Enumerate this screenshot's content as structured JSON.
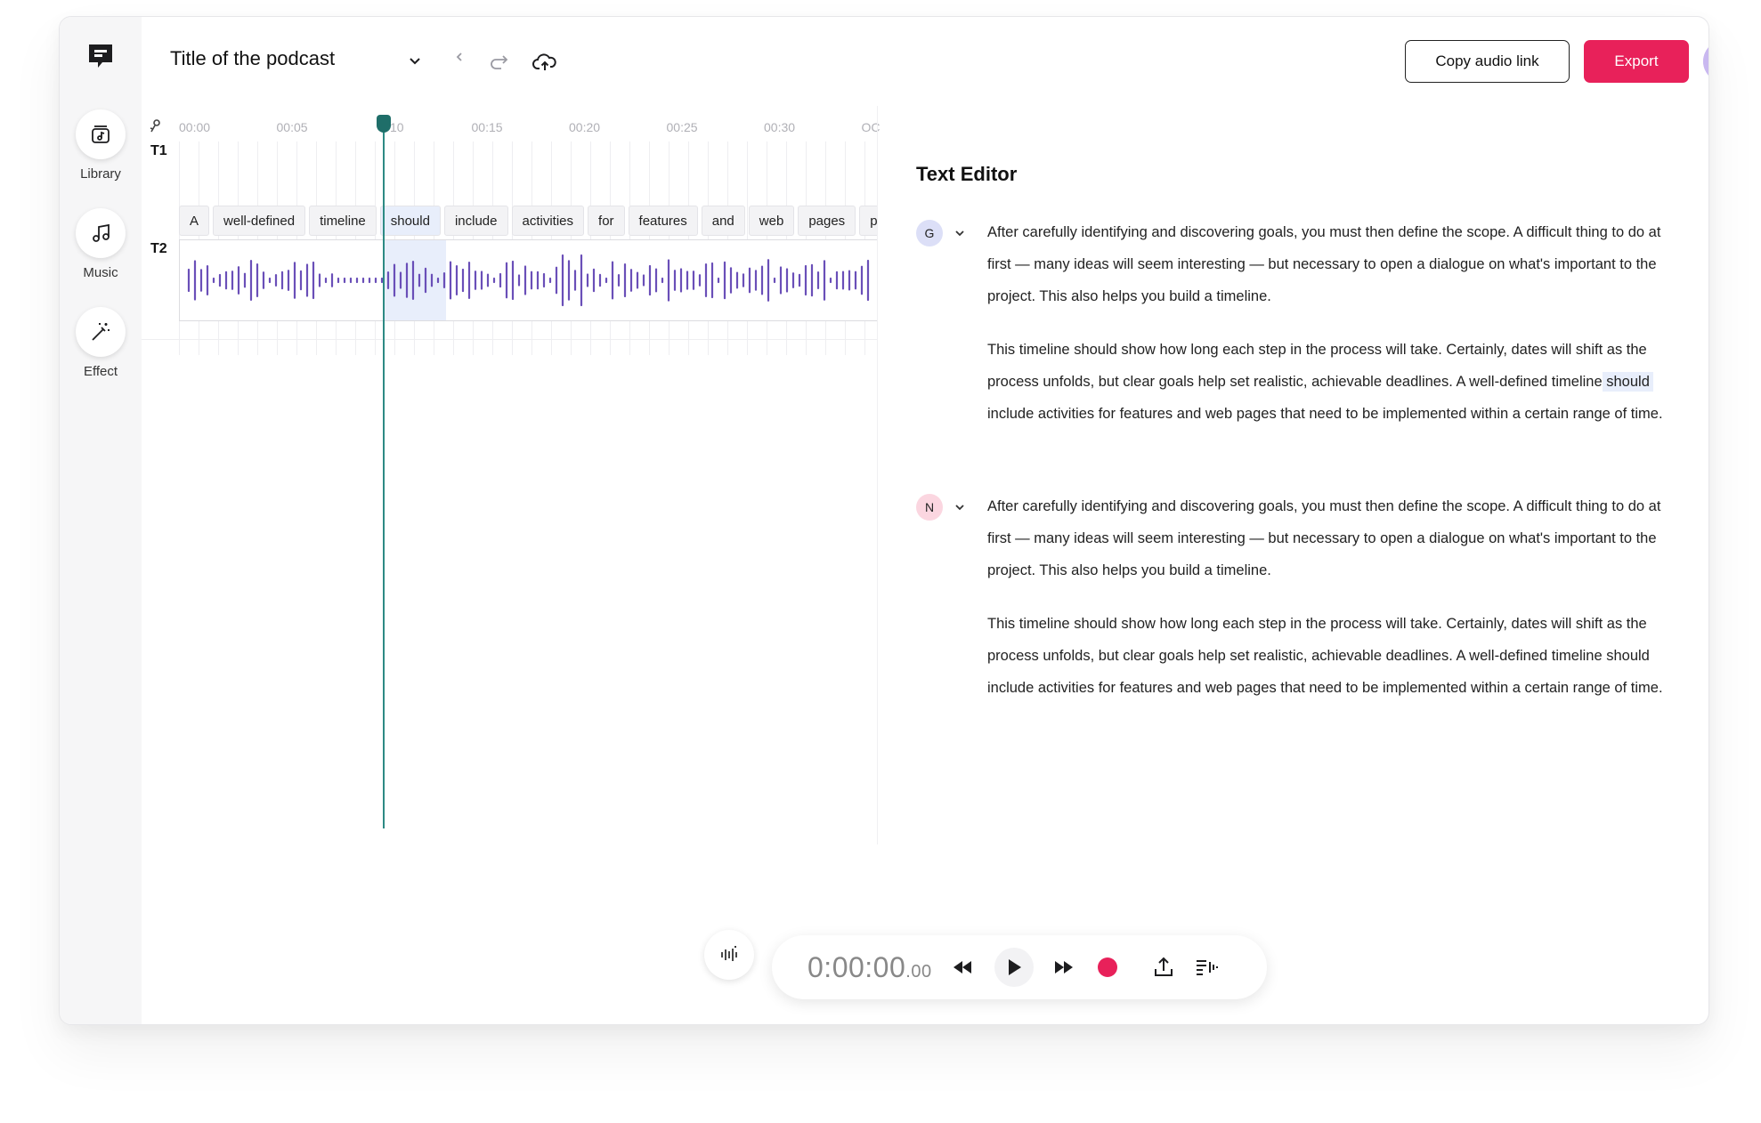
{
  "header": {
    "title": "Title of the podcast",
    "copy_label": "Copy audio link",
    "export_label": "Export"
  },
  "sidebar": {
    "items": [
      {
        "label": "Library",
        "icon": "library-icon"
      },
      {
        "label": "Music",
        "icon": "music-icon"
      },
      {
        "label": "Effect",
        "icon": "magic-wand-icon"
      }
    ]
  },
  "timeline": {
    "ruler": [
      "00:00",
      "00:05",
      "10",
      "00:15",
      "00:20",
      "00:25",
      "00:30",
      "OC"
    ],
    "tracks": [
      "T1",
      "T2"
    ],
    "words": [
      "A",
      "well-defined",
      "timeline",
      "should",
      "include",
      "activities",
      "for",
      "features",
      "and",
      "web",
      "pages",
      "p"
    ],
    "active_word_index": 3
  },
  "editor": {
    "title": "Text Editor",
    "blocks": [
      {
        "speaker": "G",
        "p1": "After carefully identifying and discovering goals, you must then define the scope. A difficult thing to do at first — many ideas will seem interesting — but necessary to open a dialogue on what's important to the project. This also helps you build a timeline.",
        "p2_before": "This timeline should show how long each step in the process will take. Certainly, dates will shift as the process unfolds, but clear goals help set realistic, achievable deadlines. A well-defined timeline",
        "p2_highlight": "should",
        "p2_after": "include activities for features and web pages that need to be implemented within a certain range of time."
      },
      {
        "speaker": "N",
        "p1": "After carefully identifying and discovering goals, you must then define the scope. A difficult thing to do at first — many ideas will seem interesting — but necessary to open a dialogue on what's important to the project. This also helps you build a timeline.",
        "p2": "This timeline should show how long each step in the process will take. Certainly, dates will shift as the process unfolds, but clear goals help set realistic, achievable deadlines. A well-defined timeline should include activities for features and web pages that need to be implemented within a certain range of time."
      }
    ]
  },
  "player": {
    "time_main": "0:00:00",
    "time_frac": ".00"
  },
  "colors": {
    "accent": "#e8215a",
    "playhead": "#2d8a84",
    "waveform": "#6a4fb8",
    "speaker_g": "#dcdff7",
    "speaker_n": "#fbd6e0"
  }
}
